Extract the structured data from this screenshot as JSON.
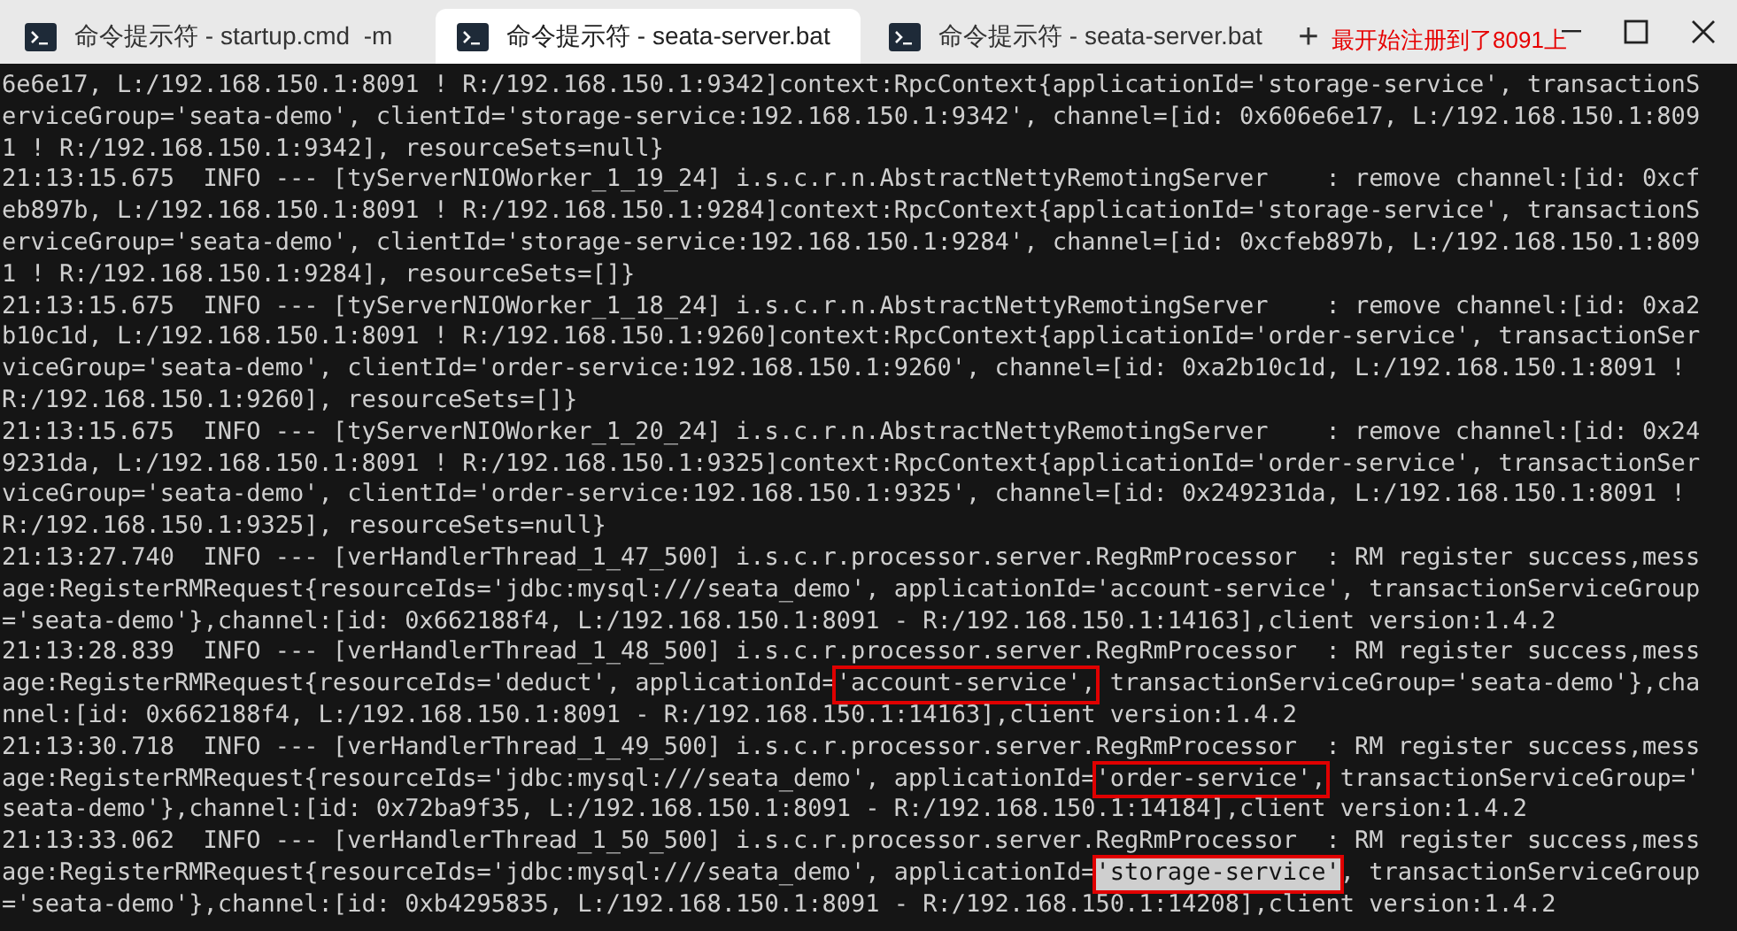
{
  "tabs": [
    {
      "title": "命令提示符 - startup.cmd  -m",
      "selected": false
    },
    {
      "title": "命令提示符 - seata-server.bat",
      "selected": true
    },
    {
      "title": "命令提示符 - seata-server.bat",
      "selected": false
    }
  ],
  "new_tab": "+",
  "annotation": "最开始注册到了8091上",
  "lines": [
    [
      {
        "text": "6e6e17, L:/192.168.150.1:8091 ! R:/192.168.150.1:9342]context:RpcContext{applicationId='storage-service', transactionS"
      }
    ],
    [
      {
        "text": "erviceGroup='seata-demo', clientId='storage-service:192.168.150.1:9342', channel=[id: 0x606e6e17, L:/192.168.150.1:809"
      }
    ],
    [
      {
        "text": "1 ! R:/192.168.150.1:9342], resourceSets=null}"
      }
    ],
    [
      {
        "text": "21:13:15.675  INFO --- [tyServerNIOWorker_1_19_24] i.s.c.r.n.AbstractNettyRemotingServer    : remove channel:[id: 0xcf"
      }
    ],
    [
      {
        "text": "eb897b, L:/192.168.150.1:8091 ! R:/192.168.150.1:9284]context:RpcContext{applicationId='storage-service', transactionS"
      }
    ],
    [
      {
        "text": "erviceGroup='seata-demo', clientId='storage-service:192.168.150.1:9284', channel=[id: 0xcfeb897b, L:/192.168.150.1:809"
      }
    ],
    [
      {
        "text": "1 ! R:/192.168.150.1:9284], resourceSets=[]}"
      }
    ],
    [
      {
        "text": "21:13:15.675  INFO --- [tyServerNIOWorker_1_18_24] i.s.c.r.n.AbstractNettyRemotingServer    : remove channel:[id: 0xa2"
      }
    ],
    [
      {
        "text": "b10c1d, L:/192.168.150.1:8091 ! R:/192.168.150.1:9260]context:RpcContext{applicationId='order-service', transactionSer"
      }
    ],
    [
      {
        "text": "viceGroup='seata-demo', clientId='order-service:192.168.150.1:9260', channel=[id: 0xa2b10c1d, L:/192.168.150.1:8091 !"
      }
    ],
    [
      {
        "text": "R:/192.168.150.1:9260], resourceSets=[]}"
      }
    ],
    [
      {
        "text": "21:13:15.675  INFO --- [tyServerNIOWorker_1_20_24] i.s.c.r.n.AbstractNettyRemotingServer    : remove channel:[id: 0x24"
      }
    ],
    [
      {
        "text": "9231da, L:/192.168.150.1:8091 ! R:/192.168.150.1:9325]context:RpcContext{applicationId='order-service', transactionSer"
      }
    ],
    [
      {
        "text": "viceGroup='seata-demo', clientId='order-service:192.168.150.1:9325', channel=[id: 0x249231da, L:/192.168.150.1:8091 !"
      }
    ],
    [
      {
        "text": "R:/192.168.150.1:9325], resourceSets=null}"
      }
    ],
    [
      {
        "text": "21:13:27.740  INFO --- [verHandlerThread_1_47_500] i.s.c.r.processor.server.RegRmProcessor  : RM register success,mess"
      }
    ],
    [
      {
        "text": "age:RegisterRMRequest{resourceIds='jdbc:mysql:///seata_demo', applicationId='account-service', transactionServiceGroup"
      }
    ],
    [
      {
        "text": "='seata-demo'},channel:[id: 0x662188f4, L:/192.168.150.1:8091 - R:/192.168.150.1:14163],client version:1.4.2"
      }
    ],
    [
      {
        "text": "21:13:28.839  INFO --- [verHandlerThread_1_48_500] i.s.c.r.processor.server.RegRmProcessor  : RM register success,mess"
      }
    ],
    [
      {
        "text": "age:RegisterRMRequest{resourceIds='deduct', applicationId="
      },
      {
        "text": "'account-service',",
        "boxed": true,
        "selected": false
      },
      {
        "text": " transactionServiceGroup='seata-demo'},cha"
      }
    ],
    [
      {
        "text": "nnel:[id: 0x662188f4, L:/192.168.150.1:8091 - R:/192.168.150.1:14163],client version:1.4.2"
      }
    ],
    [
      {
        "text": "21:13:30.718  INFO --- [verHandlerThread_1_49_500] i.s.c.r.processor.server.RegRmProcessor  : RM register success,mess"
      }
    ],
    [
      {
        "text": "age:RegisterRMRequest{resourceIds='jdbc:mysql:///seata_demo', applicationId="
      },
      {
        "text": "'order-service',",
        "boxed": true,
        "selected": false
      },
      {
        "text": " transactionServiceGroup='"
      }
    ],
    [
      {
        "text": "seata-demo'},channel:[id: 0x72ba9f35, L:/192.168.150.1:8091 - R:/192.168.150.1:14184],client version:1.4.2"
      }
    ],
    [
      {
        "text": "21:13:33.062  INFO --- [verHandlerThread_1_50_500] i.s.c.r.processor.server.RegRmProcessor  : RM register success,mess"
      }
    ],
    [
      {
        "text": "age:RegisterRMRequest{resourceIds='jdbc:mysql:///seata_demo', applicationId="
      },
      {
        "text": "'storage-service'",
        "boxed": true,
        "selected": true
      },
      {
        "text": ", transactionServiceGroup"
      }
    ],
    [
      {
        "text": "='seata-demo'},channel:[id: 0xb4295835, L:/192.168.150.1:8091 - R:/192.168.150.1:14208],client version:1.4.2"
      }
    ]
  ]
}
